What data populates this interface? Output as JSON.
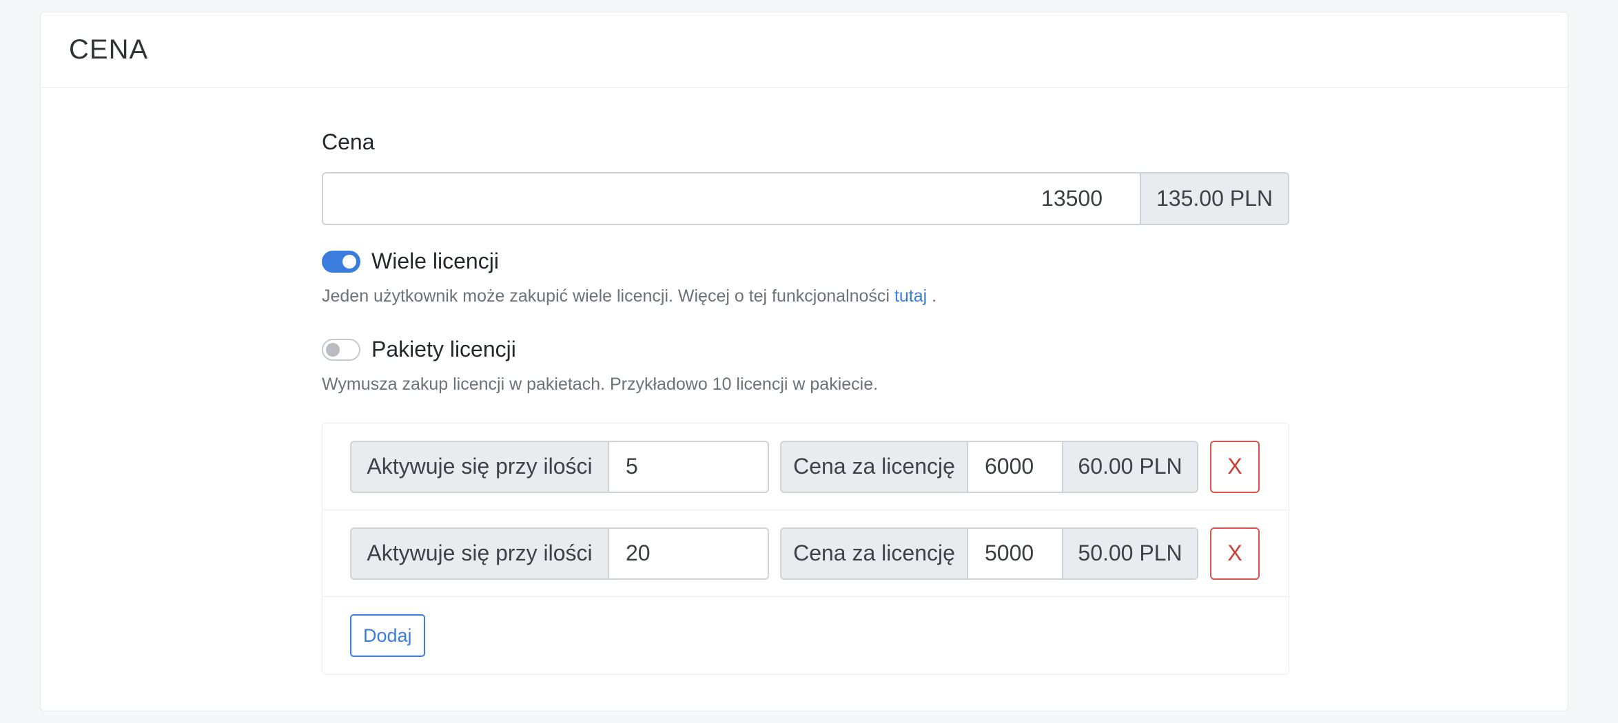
{
  "section": {
    "title": "CENA"
  },
  "price": {
    "label": "Cena",
    "value": "13500",
    "display": "135.00 PLN"
  },
  "multi_license": {
    "label": "Wiele licencji",
    "enabled": true,
    "help_text": "Jeden użytkownik może zakupić wiele licencji. Więcej o tej funkcjonalności",
    "help_link": "tutaj",
    "help_suffix": "."
  },
  "license_packages": {
    "label": "Pakiety licencji",
    "enabled": false,
    "help_text": "Wymusza zakup licencji w pakietach. Przykładowo 10 licencji w pakiecie."
  },
  "packages": {
    "rows": [
      {
        "qty_label": "Aktywuje się przy ilości",
        "qty": "5",
        "price_label": "Cena za licencję",
        "price": "6000",
        "price_display": "60.00 PLN",
        "remove_label": "X"
      },
      {
        "qty_label": "Aktywuje się przy ilości",
        "qty": "20",
        "price_label": "Cena za licencję",
        "price": "5000",
        "price_display": "50.00 PLN",
        "remove_label": "X"
      }
    ],
    "add_label": "Dodaj"
  },
  "colors": {
    "accent": "#3b7ddd",
    "danger": "#d9534f",
    "addon_bg": "#e9ebee"
  }
}
